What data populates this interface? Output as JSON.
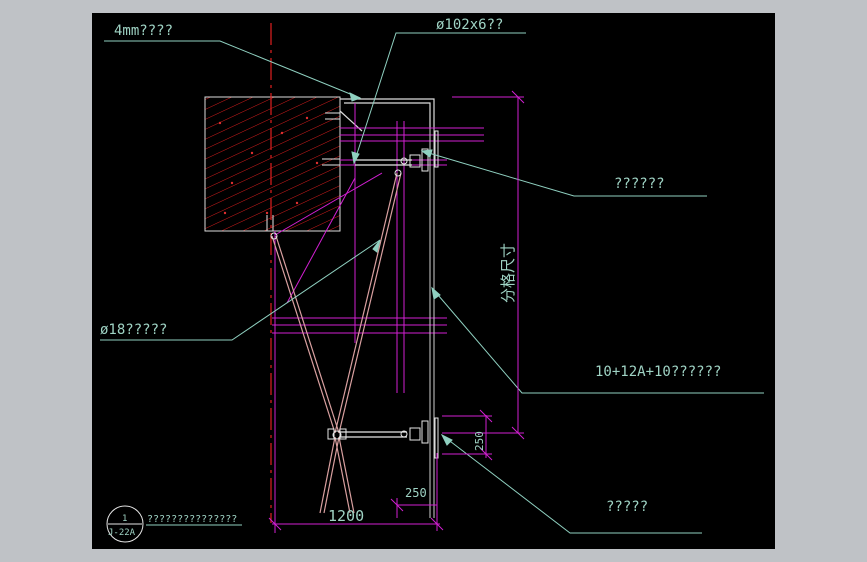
{
  "colors": {
    "background": "#000000",
    "frame": "#bfc2c6",
    "leader": "#8fd0c0",
    "dimension": "#d21fd2",
    "glass": "#cfcfcf",
    "concrete_hatch": "#d01c1c",
    "axis": "#e02020",
    "cable": "#d9a0a0",
    "text": "#9fd3c4"
  },
  "labels": {
    "glass_plate": "4mm????",
    "steel_tube": "ø102x6??",
    "bracket": "??????",
    "steel_rod": "ø18?????",
    "insulated_glass": "10+12A+10??????",
    "spider_fitting": "?????"
  },
  "dimensions": {
    "grid_size": "分格尺寸",
    "spacing_250_vertical": "250",
    "spacing_250_horizontal": "250",
    "width_1200": "1200"
  },
  "detail_mark": {
    "number": "1",
    "sheet": "J-22A",
    "title": "???????????????"
  }
}
